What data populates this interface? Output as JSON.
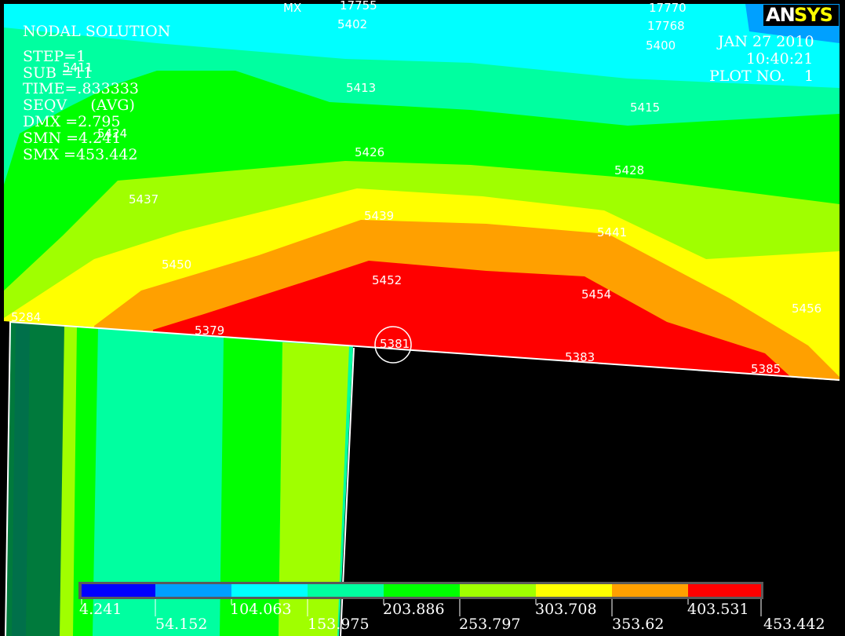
{
  "app": {
    "logo_an": "AN",
    "logo_sys": "SYS",
    "colors": {
      "logo_an": "#ffffff",
      "logo_sys": "#ffff00",
      "background": "#000000"
    }
  },
  "info": {
    "title": "NODAL SOLUTION",
    "step": "STEP=1",
    "sub": "SUB =11",
    "time": "TIME=.833333",
    "result": "SEQV     (AVG)",
    "dmx": "DMX =2.795",
    "smn": "SMN =4.241",
    "smx": "SMX =453.442"
  },
  "stamp": {
    "date": "JAN 27 2010",
    "time": "10:40:21",
    "plot_no": "PLOT NO.    1"
  },
  "nodes": {
    "mx": "MX",
    "n17755": "17755",
    "n5402": "5402",
    "n17770": "17770",
    "n17768": "17768",
    "n5400": "5400",
    "n5411": "5411",
    "n5424": "5424",
    "n5413": "5413",
    "n5415": "5415",
    "n5426": "5426",
    "n5428": "5428",
    "n5437": "5437",
    "n5439": "5439",
    "n5441": "5441",
    "n5450": "5450",
    "n5452": "5452",
    "n5454": "5454",
    "n5456": "5456",
    "n5284": "5284",
    "n5379": "5379",
    "n5381": "5381",
    "n5383": "5383",
    "n5385": "5385"
  },
  "legend": {
    "colors": [
      "#0000ff",
      "#00a0ff",
      "#00ffff",
      "#00ffa0",
      "#00ff00",
      "#a0ff00",
      "#ffff00",
      "#ffa000",
      "#ff0000"
    ],
    "labels_top": [
      "4.241",
      "104.063",
      "203.886",
      "303.708",
      "403.531"
    ],
    "labels_bottom": [
      "54.152",
      "153.975",
      "253.797",
      "353.62",
      "453.442"
    ]
  }
}
